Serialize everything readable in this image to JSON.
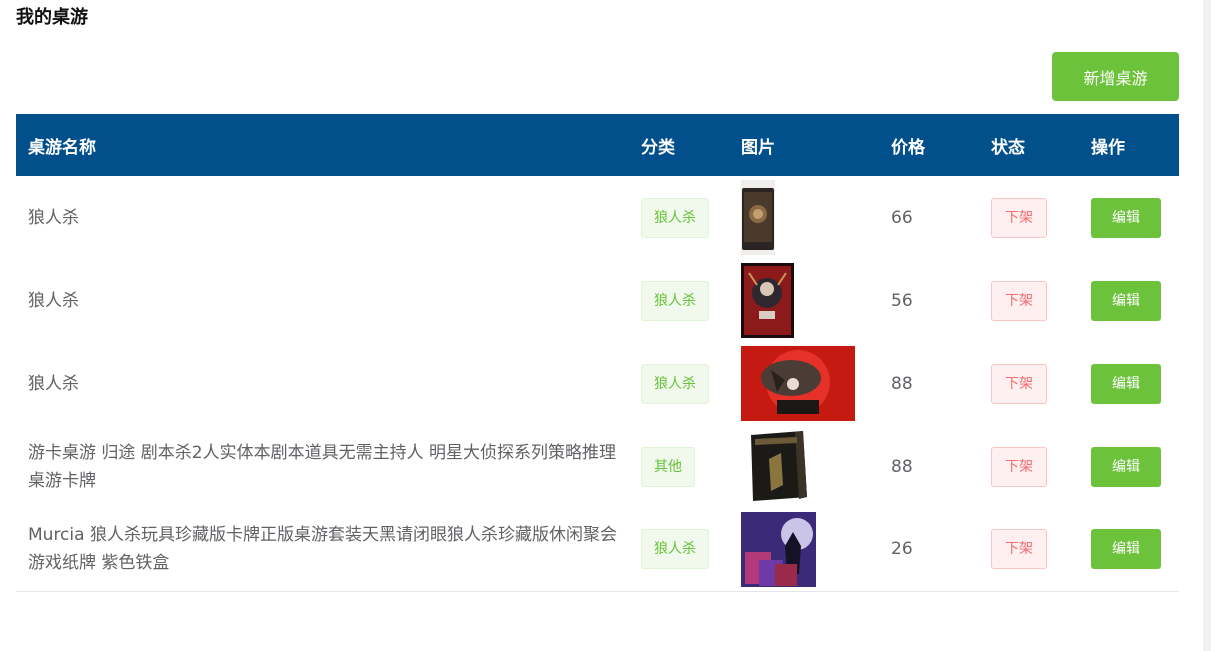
{
  "page": {
    "title": "我的桌游"
  },
  "toolbar": {
    "add_label": "新增桌游"
  },
  "table": {
    "headers": {
      "name": "桌游名称",
      "category": "分类",
      "image": "图片",
      "price": "价格",
      "status": "状态",
      "action": "操作"
    },
    "rows": [
      {
        "name": "狼人杀",
        "category": "狼人杀",
        "price": "66",
        "status": "下架",
        "action": "编辑"
      },
      {
        "name": "狼人杀",
        "category": "狼人杀",
        "price": "56",
        "status": "下架",
        "action": "编辑"
      },
      {
        "name": "狼人杀",
        "category": "狼人杀",
        "price": "88",
        "status": "下架",
        "action": "编辑"
      },
      {
        "name": "游卡桌游 归途 剧本杀2人实体本剧本道具无需主持人 明星大侦探系列策略推理桌游卡牌",
        "category": "其他",
        "price": "88",
        "status": "下架",
        "action": "编辑"
      },
      {
        "name": "Murcia 狼人杀玩具珍藏版卡牌正版桌游套装天黑请闭眼狼人杀珍藏版休闲聚会游戏纸牌 紫色铁盒",
        "category": "狼人杀",
        "price": "26",
        "status": "下架",
        "action": "编辑"
      }
    ]
  },
  "colors": {
    "header_bg": "#014f8b",
    "primary_green": "#6cc33b",
    "danger_red": "#f56c6c"
  }
}
